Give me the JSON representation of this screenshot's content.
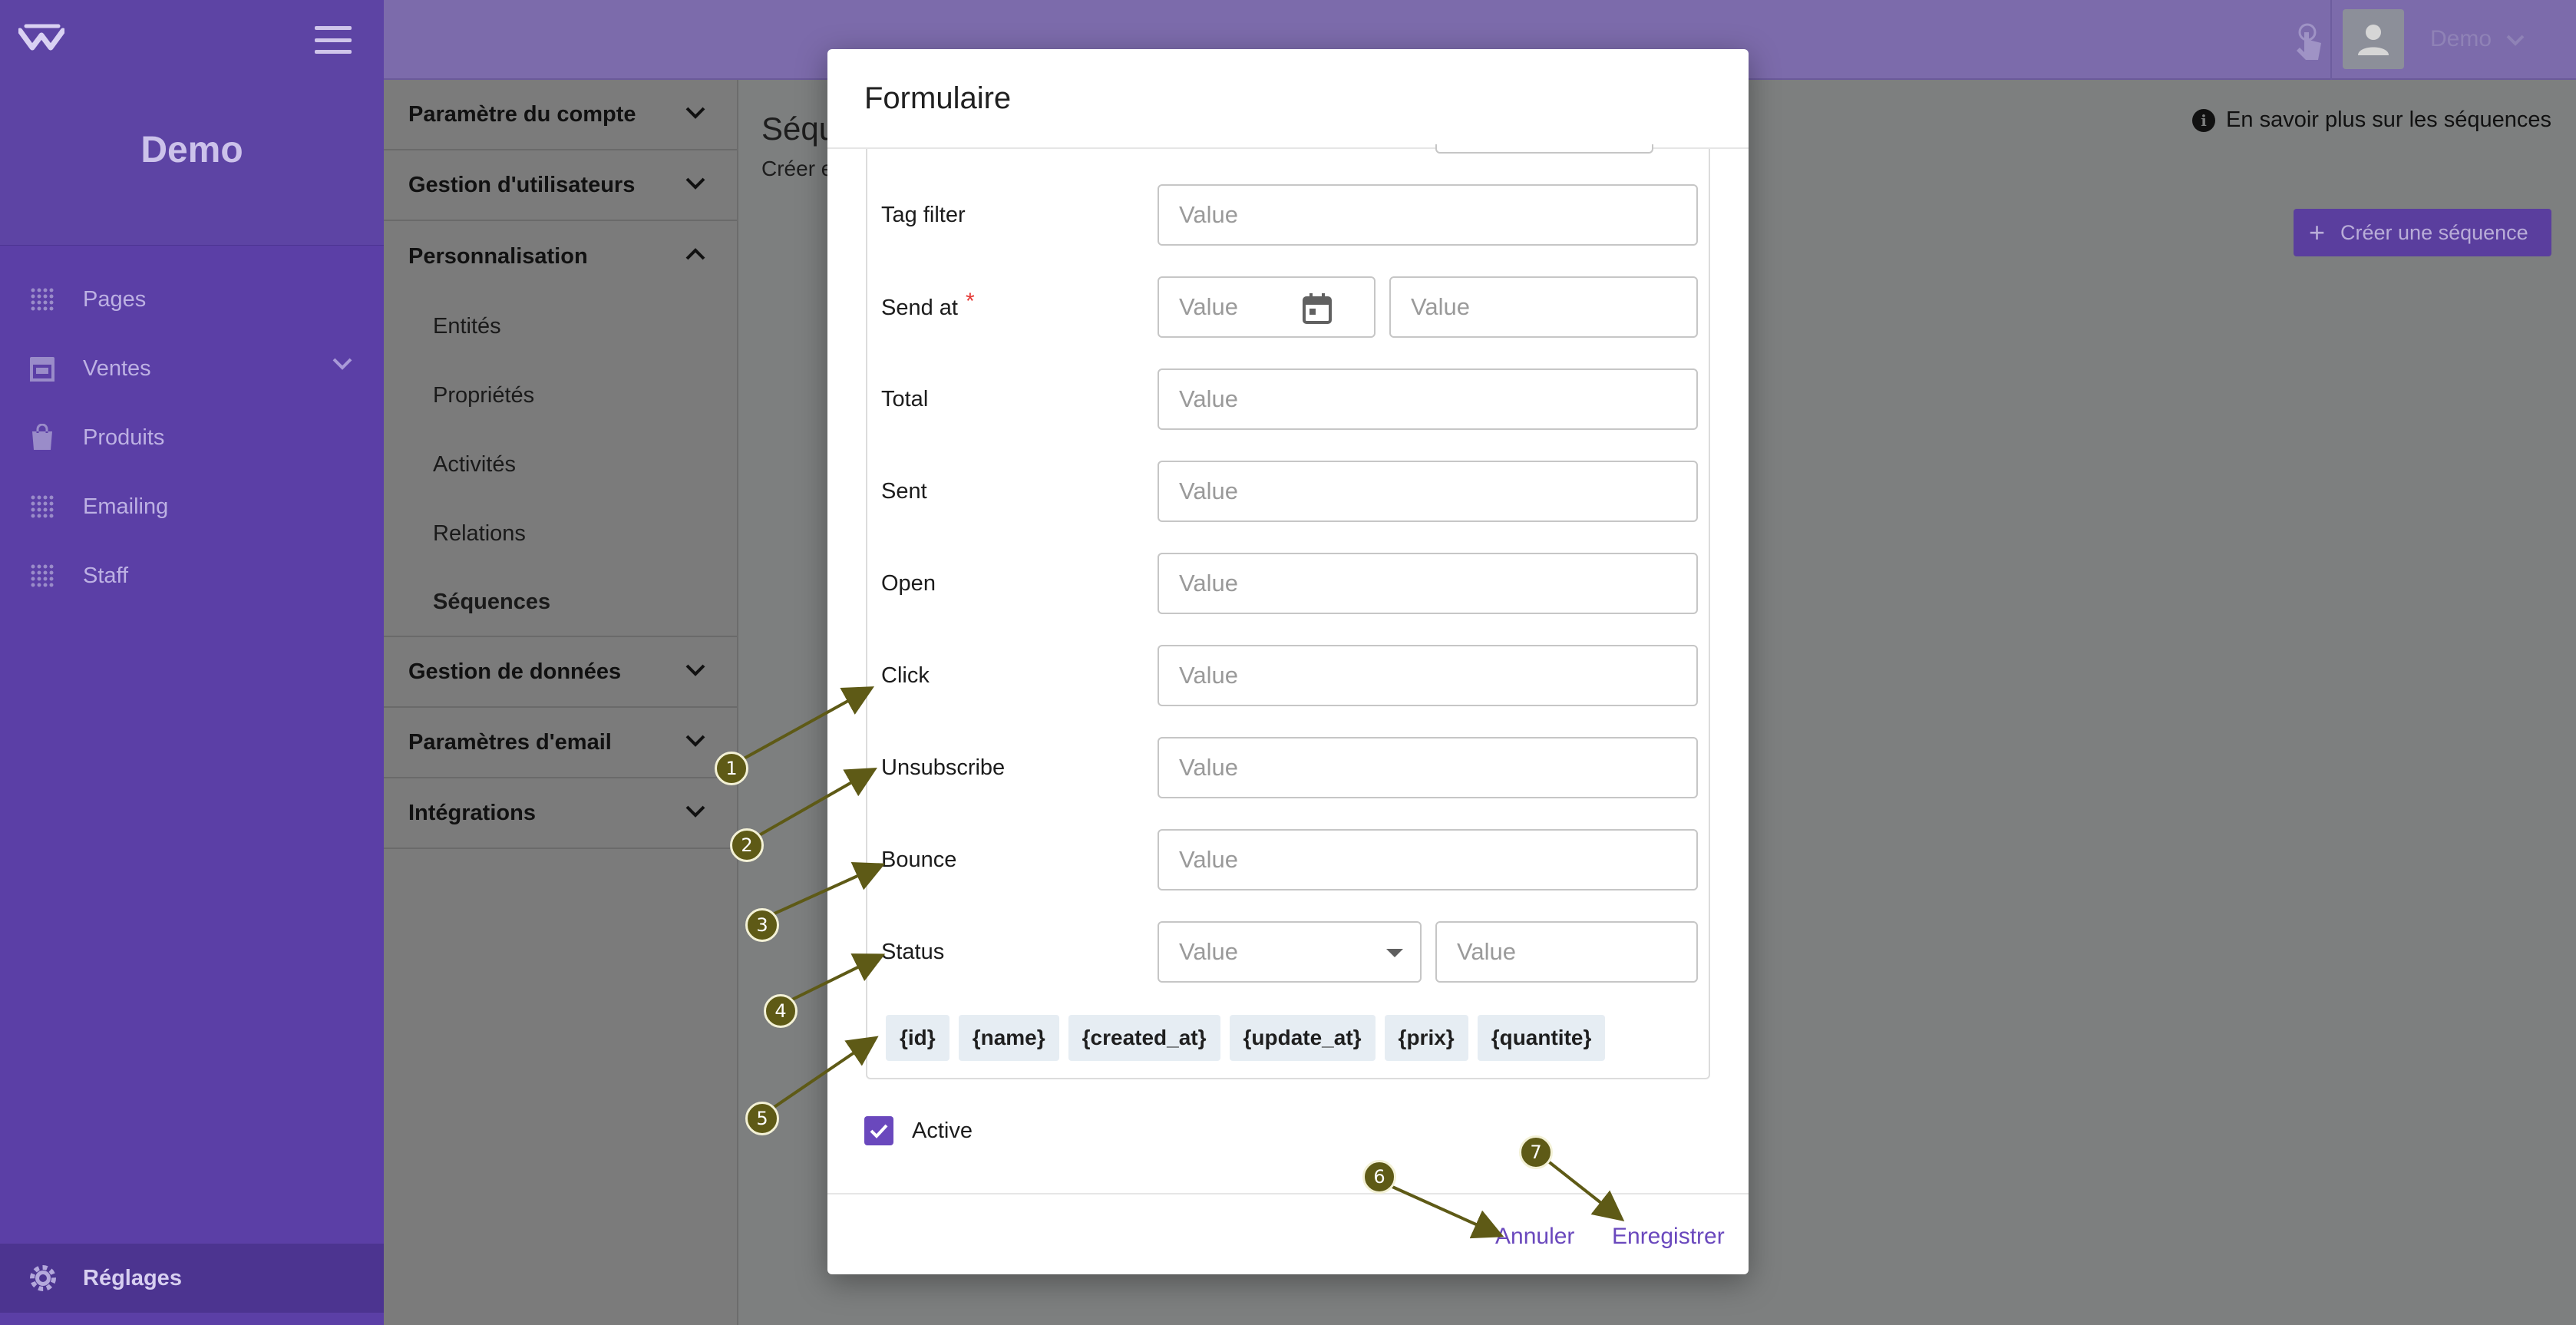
{
  "app": {
    "workspace_name": "Demo",
    "user_name": "Demo"
  },
  "sidebar": {
    "items": [
      {
        "label": "Pages",
        "icon": "grid-dots-icon"
      },
      {
        "label": "Ventes",
        "icon": "store-icon",
        "expandable": true
      },
      {
        "label": "Produits",
        "icon": "shopping-bag-icon"
      },
      {
        "label": "Emailing",
        "icon": "grid-dots-icon"
      },
      {
        "label": "Staff",
        "icon": "grid-dots-icon"
      }
    ],
    "bottom": {
      "label": "Réglages",
      "icon": "gear-icon"
    }
  },
  "settings_menu": {
    "groups": [
      {
        "label": "Paramètre du compte",
        "expanded": false
      },
      {
        "label": "Gestion d'utilisateurs",
        "expanded": false
      },
      {
        "label": "Personnalisation",
        "expanded": true
      },
      {
        "label": "Gestion de données",
        "expanded": false
      },
      {
        "label": "Paramètres d'email",
        "expanded": false
      },
      {
        "label": "Intégrations",
        "expanded": false
      }
    ],
    "sub_items": [
      "Entités",
      "Propriétés",
      "Activités",
      "Relations",
      "Séquences"
    ],
    "active_sub_item": "Séquences"
  },
  "main": {
    "title": "Séqu",
    "subtitle": "Créer e",
    "learn_more": "En savoir plus sur les séquences",
    "create_button": "Créer une séquence"
  },
  "modal": {
    "title": "Formulaire",
    "fields": [
      {
        "label": "Tag filter",
        "placeholder": "Value"
      },
      {
        "label": "Send at",
        "required": true,
        "date_placeholder": "Value",
        "time_placeholder": "Value"
      },
      {
        "label": "Total",
        "placeholder": "Value"
      },
      {
        "label": "Sent",
        "placeholder": "Value"
      },
      {
        "label": "Open",
        "placeholder": "Value"
      },
      {
        "label": "Click",
        "placeholder": "Value"
      },
      {
        "label": "Unsubscribe",
        "placeholder": "Value"
      },
      {
        "label": "Bounce",
        "placeholder": "Value"
      },
      {
        "label": "Status",
        "select_value": "Value",
        "placeholder": "Value"
      }
    ],
    "required_marker": "*",
    "chips": [
      "{id}",
      "{name}",
      "{created_at}",
      "{update_at}",
      "{prix}",
      "{quantite}"
    ],
    "active_label": "Active",
    "active_checked": true,
    "cancel_label": "Annuler",
    "save_label": "Enregistrer"
  },
  "annotations": [
    "1",
    "2",
    "3",
    "4",
    "5",
    "6",
    "7"
  ],
  "colors": {
    "sidebar_bg": "#5b3fa6",
    "accent": "#6a48bd",
    "annotation_badge": "#5e5a16",
    "overlay_gray": "#7d7f7f"
  }
}
